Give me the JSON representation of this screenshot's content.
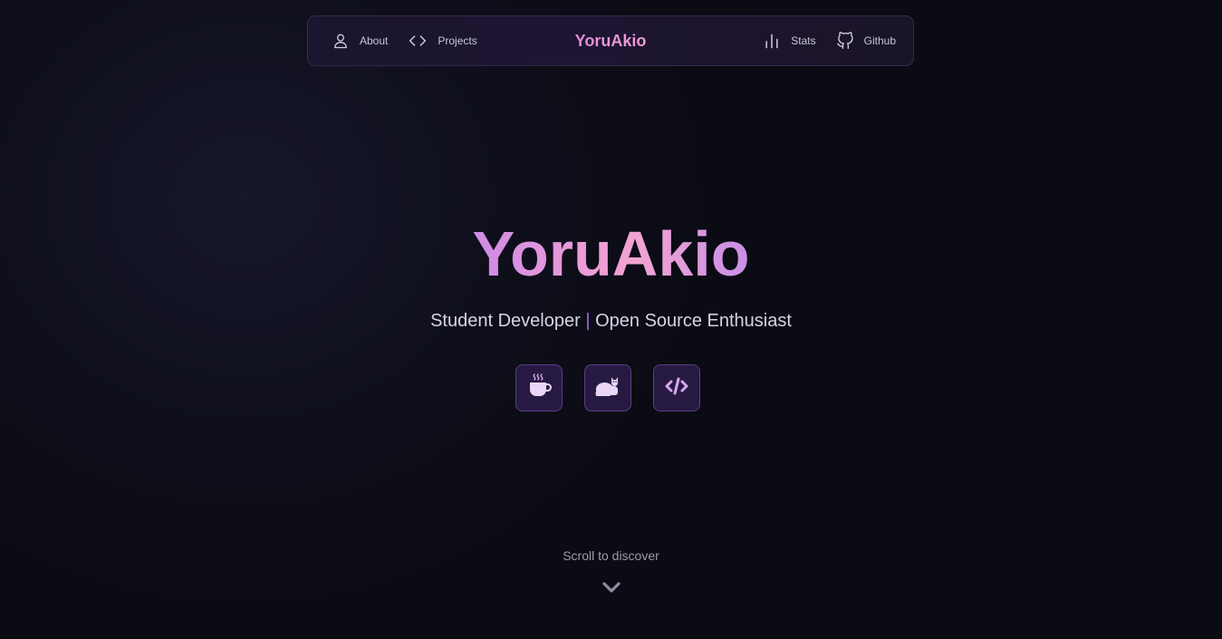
{
  "nav": {
    "brand": "YoruAkio",
    "left": [
      {
        "label": "About",
        "icon": "user-icon"
      },
      {
        "label": "Projects",
        "icon": "code-icon"
      }
    ],
    "right": [
      {
        "label": "Stats",
        "icon": "bar-chart-icon"
      },
      {
        "label": "Github",
        "icon": "github-icon"
      }
    ]
  },
  "hero": {
    "title": "YoruAkio",
    "tagline_left": "Student Developer",
    "tagline_separator": "|",
    "tagline_right": "Open Source Enthusiast",
    "icons": [
      "coffee-icon",
      "cat-icon",
      "code-tag-icon"
    ]
  },
  "scroll": {
    "label": "Scroll to discover",
    "icon": "chevron-down-icon"
  },
  "colors": {
    "accent": "#e48fd8",
    "icon_purple": "#d8a6f0",
    "separator": "#a66ad8"
  }
}
